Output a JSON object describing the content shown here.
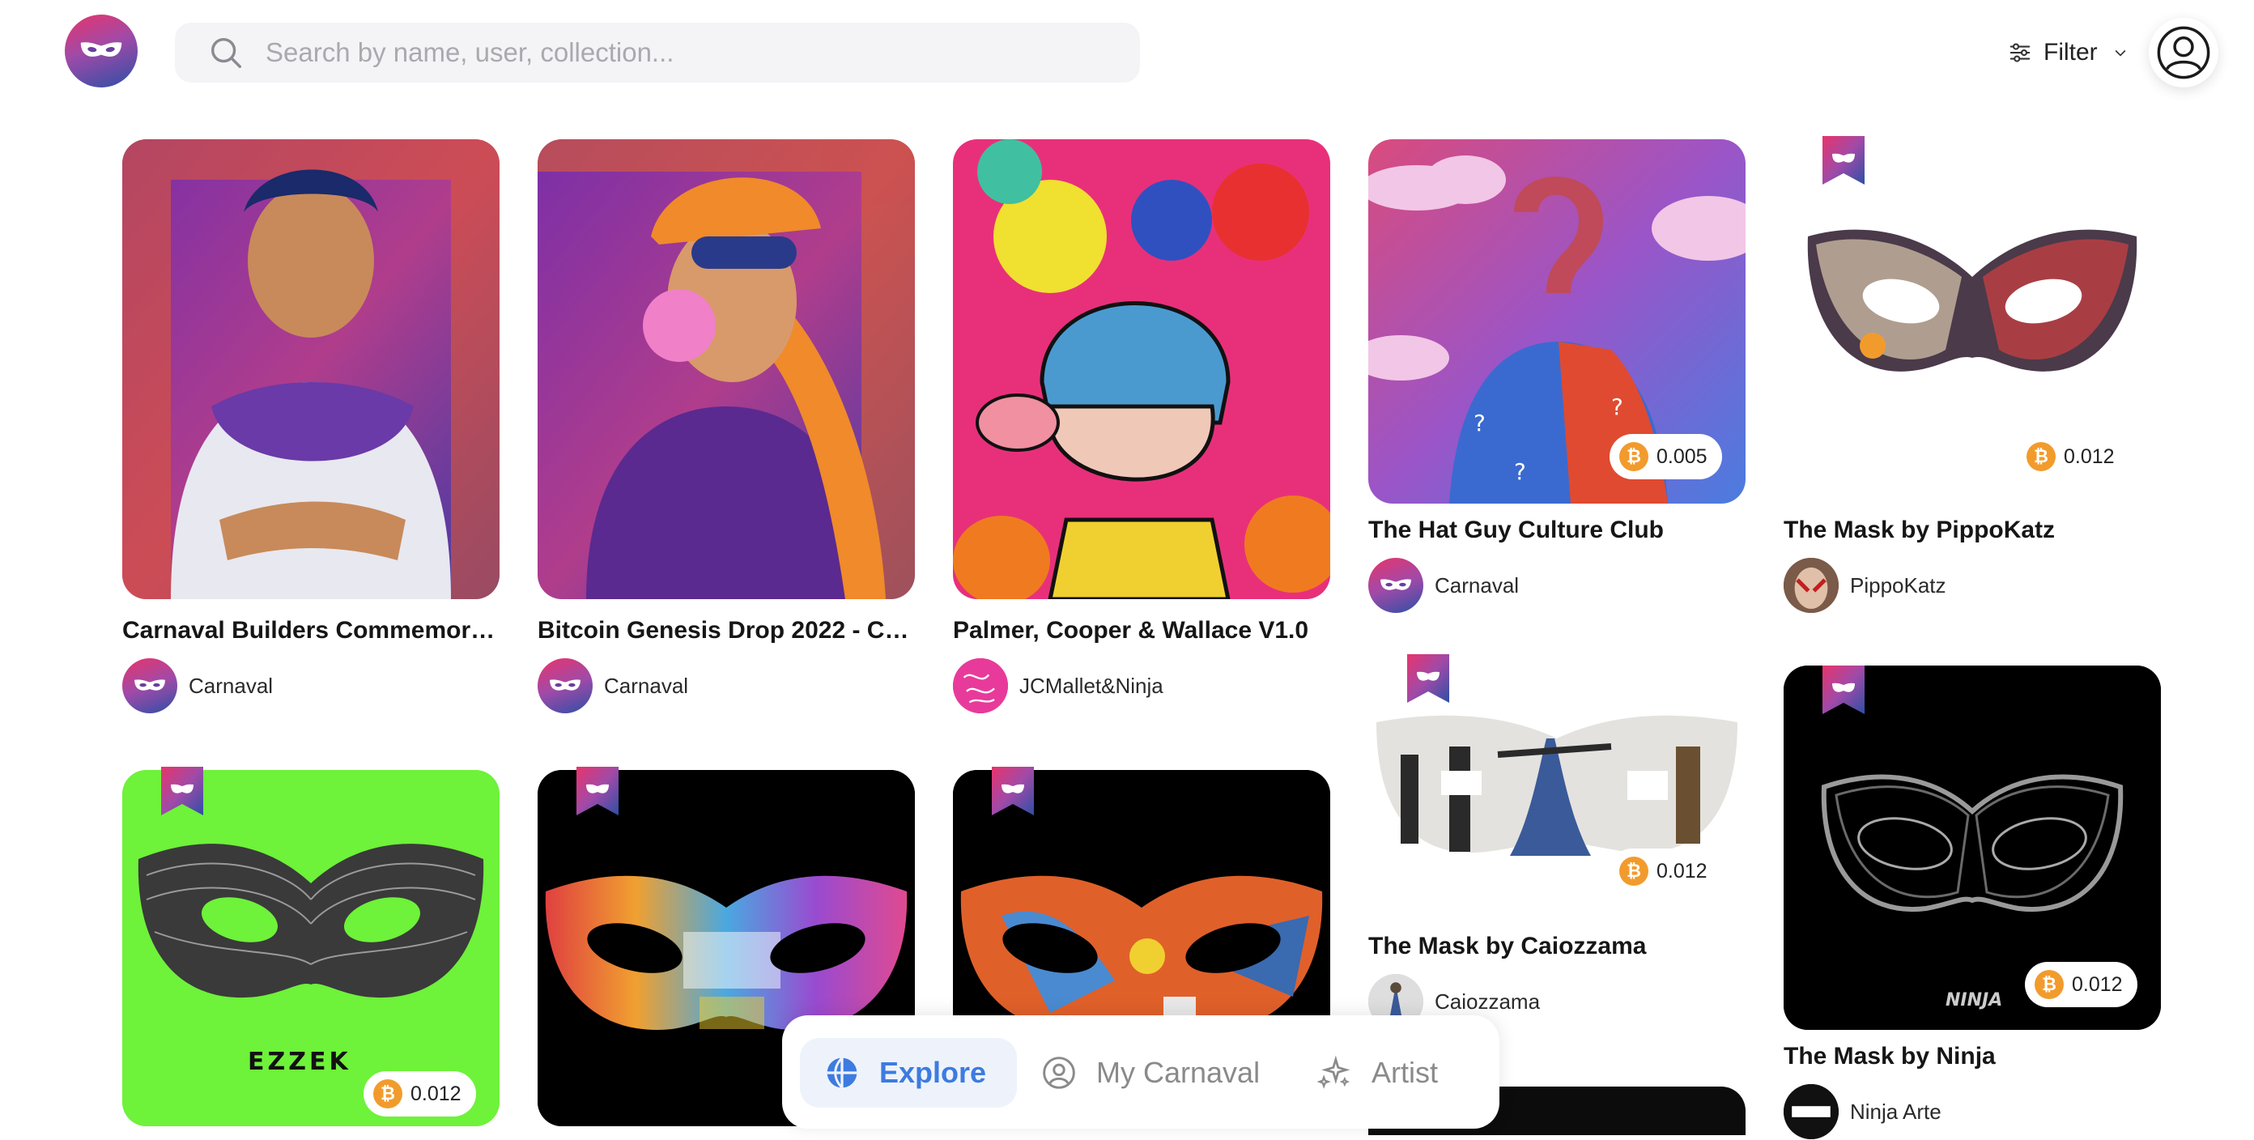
{
  "header": {
    "search_placeholder": "Search by name, user, collection...",
    "filter_label": "Filter"
  },
  "cards": [
    {
      "title": "Carnaval Builders Commemorat...",
      "creator": "Carnaval"
    },
    {
      "title": "Bitcoin Genesis Drop 2022 - Con...",
      "creator": "Carnaval"
    },
    {
      "title": "Palmer, Cooper & Wallace V1.0",
      "creator": "JCMallet&Ninja"
    },
    {
      "title": "The Hat Guy Culture Club",
      "creator": "Carnaval",
      "price": "0.005"
    },
    {
      "title": "The Mask by PippoKatz",
      "creator": "PippoKatz",
      "price": "0.012"
    },
    {
      "title": "The Mask by Caiozzama",
      "creator": "Caiozzama",
      "price": "0.012"
    },
    {
      "title": "The Mask by Ninja",
      "creator": "Ninja Arte",
      "price": "0.012",
      "art_text": "NINJA"
    },
    {
      "price": "0.012",
      "art_text": "EZZEK"
    },
    {},
    {}
  ],
  "bottom_nav": {
    "items": [
      {
        "label": "Explore",
        "active": true
      },
      {
        "label": "My Carnaval",
        "active": false
      },
      {
        "label": "Artist",
        "active": false
      }
    ]
  },
  "colors": {
    "accent": "#3d7be0",
    "btc": "#f29b2d",
    "brand_gradient": [
      "#e8346b",
      "#a04aa8",
      "#2d4fa6"
    ],
    "green_art": "#6ef23a"
  },
  "icons": [
    "carnaval-mask-logo",
    "search-icon",
    "sliders-icon",
    "chevron-down-icon",
    "user-icon",
    "bitcoin-icon",
    "bookmark-badge-icon",
    "globe-icon",
    "user-circle-icon",
    "sparkles-icon"
  ]
}
